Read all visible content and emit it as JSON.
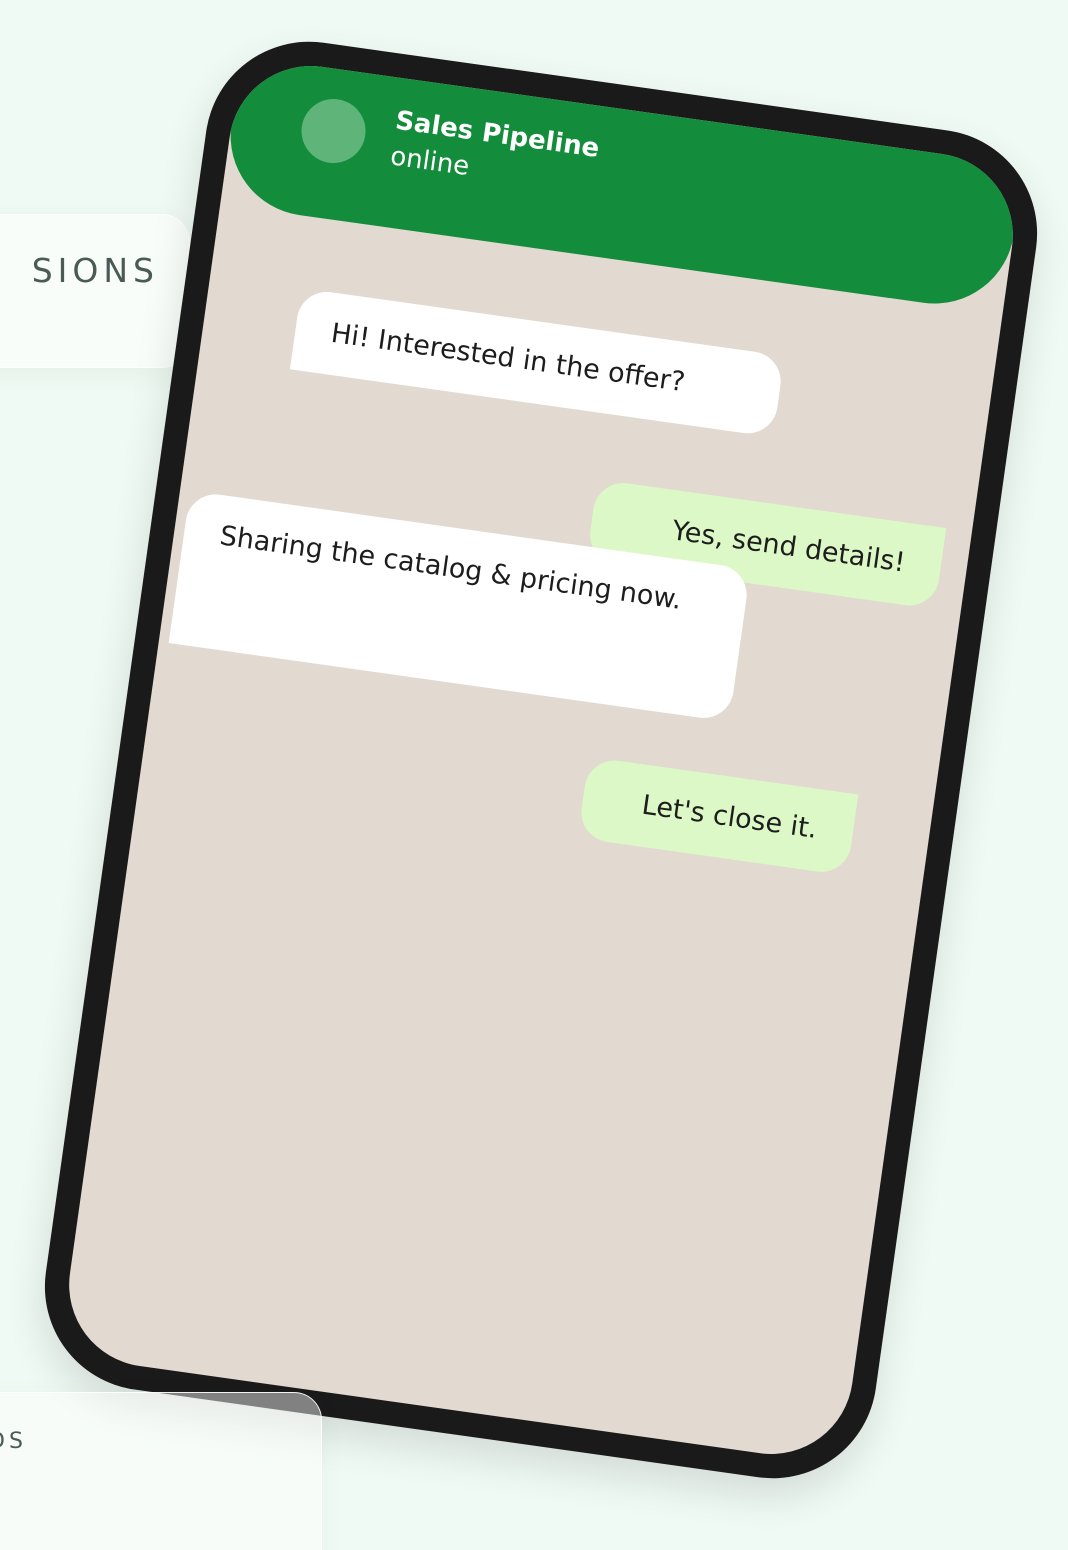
{
  "background_cards": {
    "top_label": "SIONS",
    "bottom_label": "ADS"
  },
  "chat": {
    "contact_name": "Sales Pipeline",
    "status": "online",
    "messages": [
      {
        "direction": "incoming",
        "text": "Hi! Interested in the offer?"
      },
      {
        "direction": "outgoing",
        "text": "Yes, send details!"
      },
      {
        "direction": "incoming",
        "text": "Sharing the catalog & pricing now."
      },
      {
        "direction": "outgoing",
        "text": "Let's close it."
      }
    ]
  },
  "colors": {
    "page_background": "#f0faf4",
    "header_green": "#138c3b",
    "avatar": "#5fb47a",
    "chat_background": "#e2d9d0",
    "incoming_bubble": "#ffffff",
    "outgoing_bubble": "#dcf8c6",
    "phone_frame": "#1a1a1a"
  }
}
